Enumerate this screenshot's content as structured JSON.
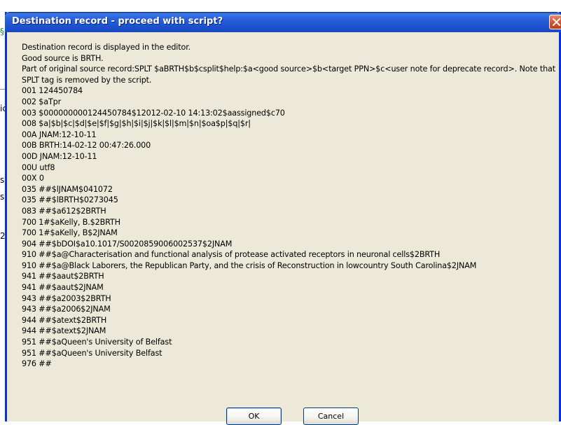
{
  "background": {
    "fragments": [
      "§",
      "ic",
      "s",
      "s",
      "2"
    ]
  },
  "dialog": {
    "title": "Destination record - proceed with script?",
    "close_icon": "close-icon",
    "lines": [
      "Destination record is displayed in the editor.",
      "Good source is BRTH.",
      "Part of original source record:SPLT $aBRTH$b$csplit$help:$a<good source>$b<target PPN>$c<user note for deprecate record>. Note that SPLT tag is removed by the script.",
      "001 124450784",
      "002 $aTpr",
      "003 $000000000124450784$12012-02-10 14:13:02$aassigned$c70",
      "008 $a|$b|$c|$d|$e|$f|$g|$h|$i|$j|$k|$l|$m|$n|$oa$p|$q|$r|",
      "00A JNAM:12-10-11",
      "00B BRTH:14-02-12 00:47:26.000",
      "00D JNAM:12-10-11",
      "00U utf8",
      "00X 0",
      "035 ##$lJNAM$041072",
      "035 ##$lBRTH$0273045",
      "083 ##$a612$2BRTH",
      "700 1#$aKelly, B.$2BRTH",
      "700 1#$aKelly, B$2JNAM",
      "904 ##$bDOI$a10.1017/S0020859006002537$2JNAM",
      "910 ##$a@Characterisation and functional analysis of protease activated receptors in neuronal cells$2BRTH",
      "910 ##$a@Black Laborers, the Republican Party, and the crisis of Reconstruction in lowcountry South Carolina$2JNAM",
      "941 ##$aaut$2BRTH",
      "941 ##$aaut$2JNAM",
      "943 ##$a2003$2BRTH",
      "943 ##$a2006$2JNAM",
      "944 ##$atext$2BRTH",
      "944 ##$atext$2JNAM",
      "951 ##$aQueen's University of Belfast",
      "951 ##$aQueen's University Belfast",
      "976 ##"
    ],
    "ok_label": "OK",
    "cancel_label": "Cancel"
  },
  "colors": {
    "titlebar": "#2a63dd",
    "dialog_bg": "#ece9d8",
    "close_button": "#d8542d",
    "button_border": "#003c74"
  }
}
